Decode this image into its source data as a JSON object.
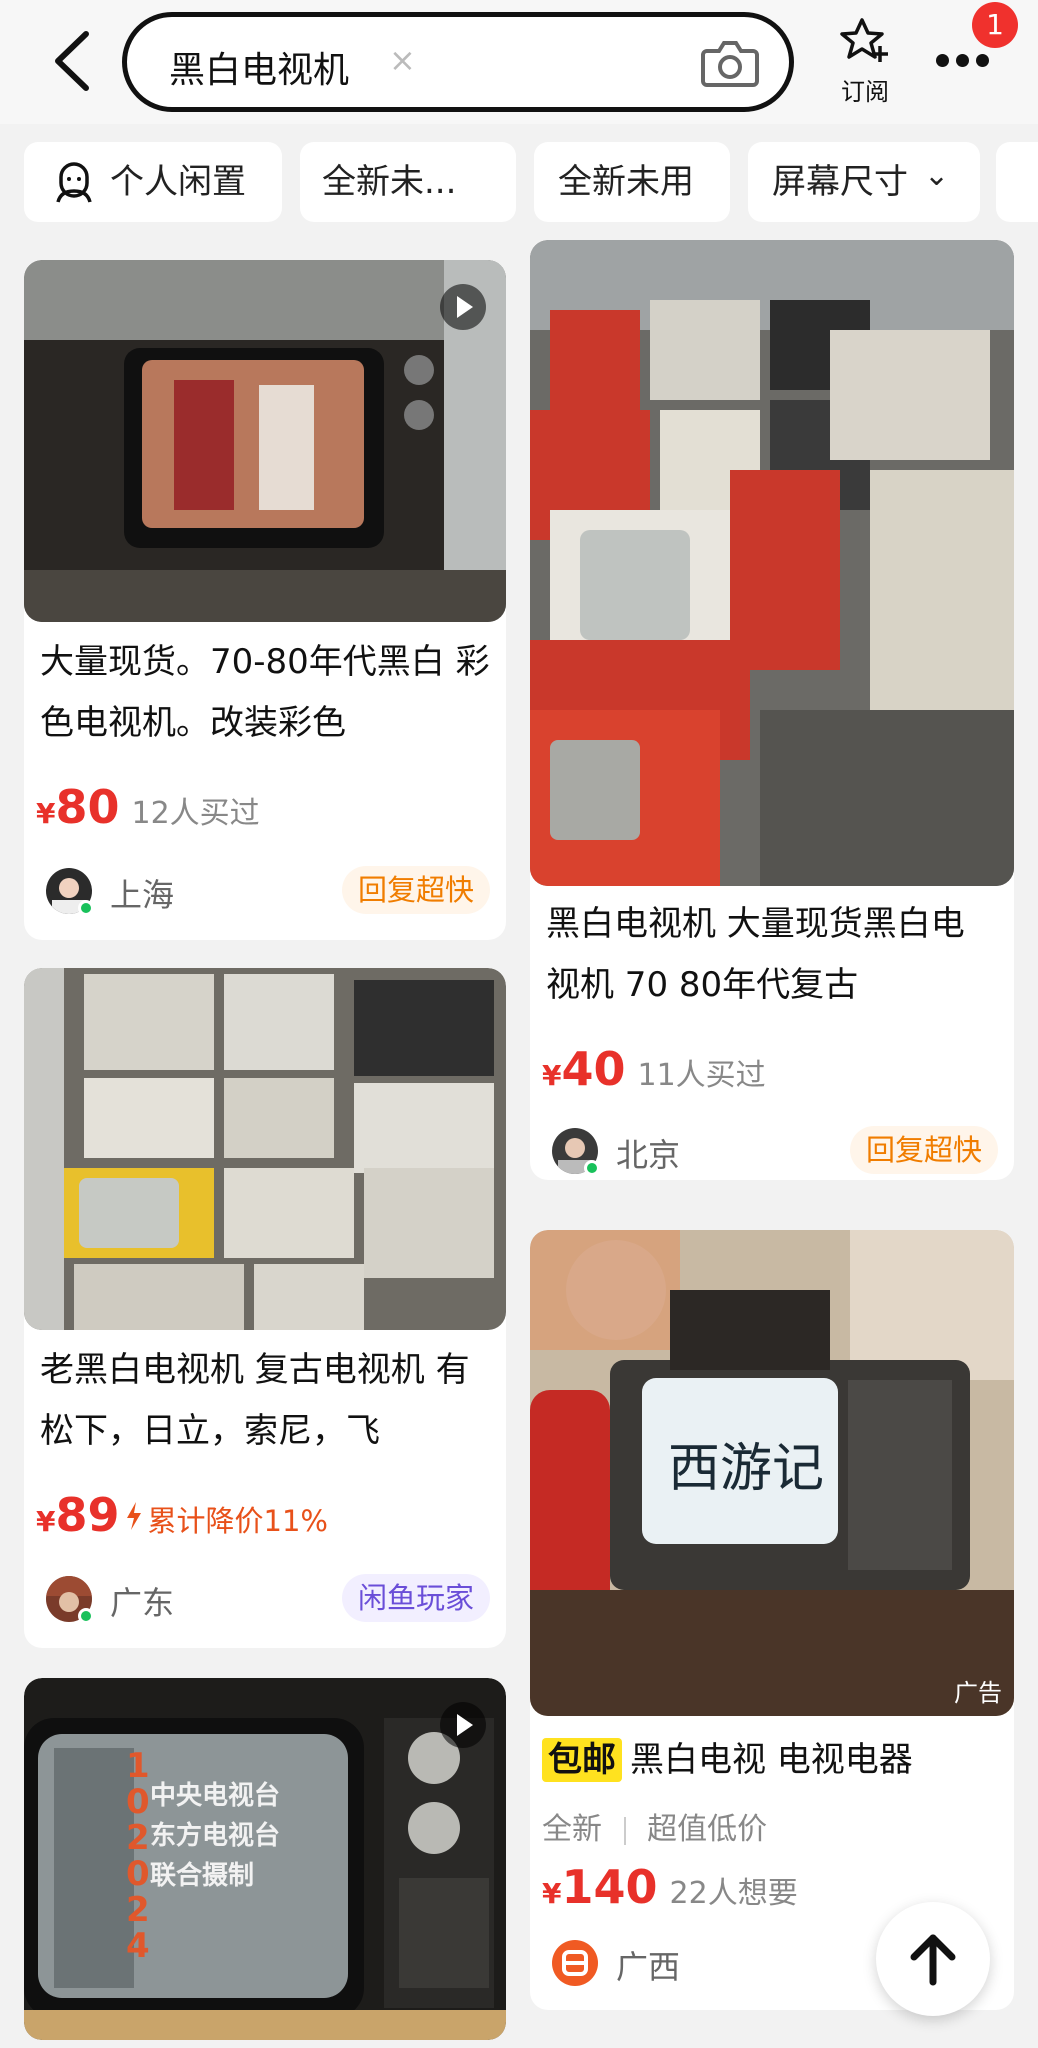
{
  "header": {
    "search_query": "黑白电视机",
    "clear_glyph": "×",
    "subscribe_label": "订阅",
    "badge_count": "1",
    "icons": [
      "back-arrow-icon",
      "camera-icon",
      "star-plus-icon",
      "more-dots-icon"
    ]
  },
  "filters": [
    {
      "label": "个人闲置",
      "icon": "person-icon"
    },
    {
      "label": "全新未..."
    },
    {
      "label": "全新未用"
    },
    {
      "label": "屏幕尺寸",
      "caret": "⌄"
    }
  ],
  "items": [
    {
      "title": "大量现货。70-80年代黑白 彩色电视机。改装彩色",
      "currency": "¥",
      "price": "80",
      "meta": "12人买过",
      "city": "上海",
      "tag": "回复超快",
      "has_video": true
    },
    {
      "title": "黑白电视机  大量现货黑白电视机  70  80年代复古",
      "currency": "¥",
      "price": "40",
      "meta": "11人买过",
      "city": "北京",
      "tag": "回复超快"
    },
    {
      "title": "老黑白电视机 复古电视机 有松下，日立，索尼，飞",
      "currency": "¥",
      "price": "89",
      "drop_icon": "lightning-icon",
      "drop_text": "累计降价11%",
      "city": "广东",
      "tag": "闲鱼玩家"
    },
    {
      "badge": "包邮",
      "title": "黑白电视 电视电器",
      "condition": "全新",
      "condition_note": "超值低价",
      "currency": "¥",
      "price": "140",
      "meta": "22人想要",
      "city": "广西",
      "ad_label": "广告",
      "screen_text": "西游记"
    },
    {
      "screen_lines": [
        "中央电视台",
        "东方电视台",
        "联合摄制"
      ],
      "overlay_text": "10 2024",
      "has_video": true
    }
  ],
  "colors": {
    "price_red": "#e8312a",
    "tag_orange": "#f07d00",
    "tag_purple": "#6a4ed8",
    "badge_yellow": "#ffe21f",
    "online_green": "#19c15b"
  }
}
